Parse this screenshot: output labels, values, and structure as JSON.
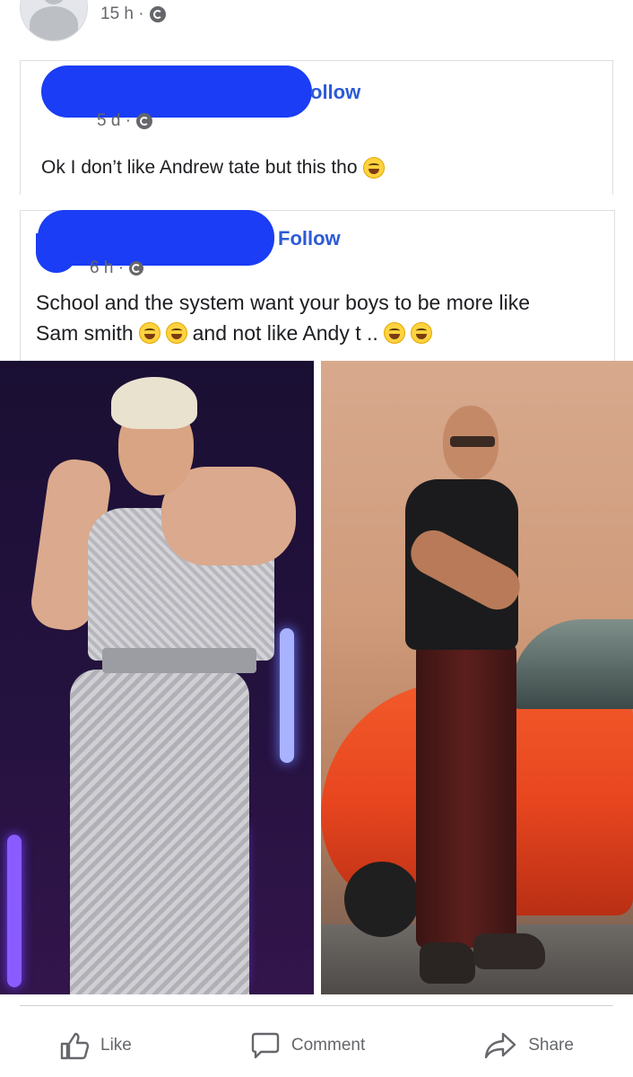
{
  "top": {
    "time": "15 h ·"
  },
  "shared_post_1": {
    "follow": "ollow",
    "time": "5 d ·",
    "text": "Ok I don’t like Andrew tate but this tho"
  },
  "shared_post_2": {
    "follow": "Follow",
    "time": "6 h ·",
    "text_line1": "School and the system want your boys to be more like",
    "text_line2_a": "Sam smith",
    "text_line2_b": "and not like Andy t .."
  },
  "actions": {
    "like": "Like",
    "comment": "Comment",
    "share": "Share"
  },
  "colors": {
    "link": "#2d5ad6",
    "redaction": "#1a3df5",
    "muted": "#65676b"
  }
}
